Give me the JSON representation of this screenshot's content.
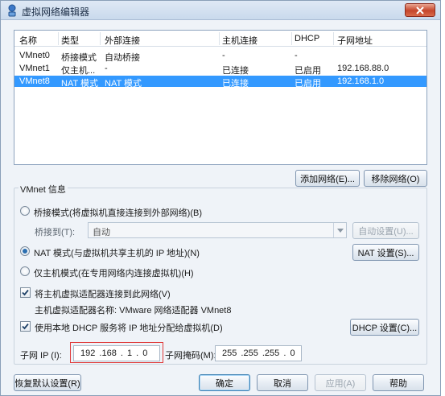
{
  "window": {
    "title": "虚拟网络编辑器"
  },
  "list": {
    "headers": [
      "名称",
      "类型",
      "外部连接",
      "主机连接",
      "DHCP",
      "子网地址"
    ],
    "rows": [
      {
        "name": "VMnet0",
        "type": "桥接模式",
        "external": "自动桥接",
        "host": "-",
        "dhcp": "-",
        "subnet": ""
      },
      {
        "name": "VMnet1",
        "type": "仅主机...",
        "external": "-",
        "host": "已连接",
        "dhcp": "已启用",
        "subnet": "192.168.88.0"
      },
      {
        "name": "VMnet8",
        "type": "NAT 模式",
        "external": "NAT 模式",
        "host": "已连接",
        "dhcp": "已启用",
        "subnet": "192.168.1.0"
      }
    ],
    "selected_index": 2
  },
  "list_buttons": {
    "add": "添加网络(E)...",
    "remove": "移除网络(O)"
  },
  "vmnet_info": {
    "group_label": "VMnet 信息",
    "bridged_radio": "桥接模式(将虚拟机直接连接到外部网络)(B)",
    "bridged_to_label": "桥接到(T):",
    "bridged_to_value": "自动",
    "auto_settings_button": "自动设置(U)...",
    "nat_radio": "NAT 模式(与虚拟机共享主机的 IP 地址)(N)",
    "nat_settings_button": "NAT 设置(S)...",
    "hostonly_radio": "仅主机模式(在专用网络内连接虚拟机)(H)",
    "selected_mode": "nat",
    "connect_adapter_check": "将主机虚拟适配器连接到此网络(V)",
    "connect_adapter_checked": true,
    "adapter_name_text": "主机虚拟适配器名称: VMware 网络适配器 VMnet8",
    "use_dhcp_check": "使用本地 DHCP 服务将 IP 地址分配给虚拟机(D)",
    "use_dhcp_checked": true,
    "dhcp_settings_button": "DHCP 设置(C)...",
    "subnet_ip_label": "子网 IP (I):",
    "subnet_ip_value": "192 .168 . 1 . 0",
    "subnet_mask_label": "子网掩码(M):",
    "subnet_mask_value": "255 .255 .255 . 0"
  },
  "footer": {
    "restore": "恢复默认设置(R)",
    "ok": "确定",
    "cancel": "取消",
    "apply": "应用(A)",
    "help": "帮助"
  },
  "colors": {
    "selection": "#3399ff",
    "highlight_box": "#e03b3b"
  }
}
